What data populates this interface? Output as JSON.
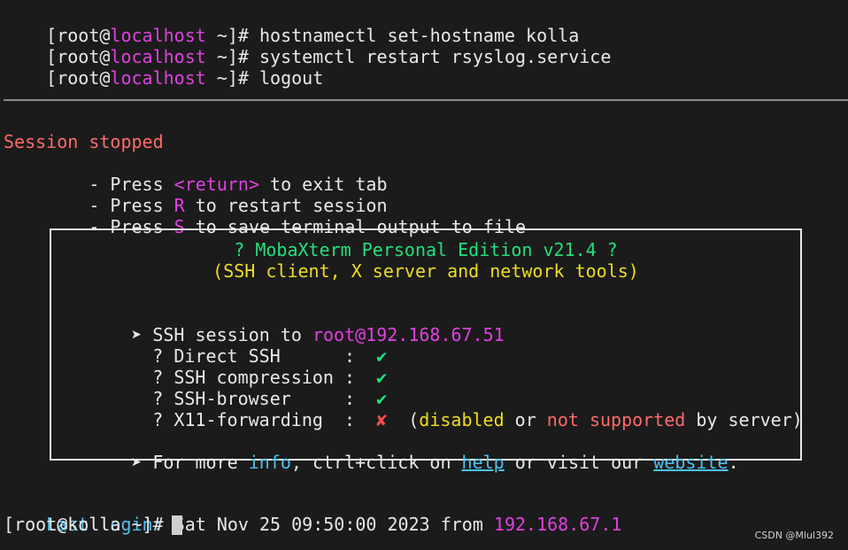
{
  "colors": {
    "background": "#1b1b1b",
    "text": "#e8e8e8",
    "magenta": "#e040e0",
    "red": "#ff6a6a",
    "cyan": "#4cc2f0",
    "green": "#22e07a",
    "yellow": "#eedd22",
    "divider": "#8a8a8a"
  },
  "history": [
    {
      "prompt_user": "[root@",
      "prompt_host": "localhost",
      "prompt_rest": " ~]# ",
      "command": "hostnamectl set-hostname kolla"
    },
    {
      "prompt_user": "[root@",
      "prompt_host": "localhost",
      "prompt_rest": " ~]# ",
      "command": "systemctl restart rsyslog.service"
    },
    {
      "prompt_user": "[root@",
      "prompt_host": "localhost",
      "prompt_rest": " ~]# ",
      "command": "logout"
    }
  ],
  "session": {
    "stopped_text": "Session stopped",
    "instructions": [
      {
        "prefix": "    - Press ",
        "key": "<return>",
        "suffix": " to exit tab"
      },
      {
        "prefix": "    - Press ",
        "key": "R",
        "suffix": " to restart session"
      },
      {
        "prefix": "    - Press ",
        "key": "S",
        "suffix": " to save terminal output to file"
      }
    ]
  },
  "mobabox": {
    "title": "? MobaXterm Personal Edition v21.4 ?",
    "subtitle": "(SSH client, X server and network tools)",
    "ssh_label": "➤ SSH session to ",
    "ssh_target": "root@192.168.67.51",
    "features": [
      {
        "label": "? Direct SSH      :  ",
        "mark": "✔",
        "mark_color": "green"
      },
      {
        "label": "? SSH compression :  ",
        "mark": "✔",
        "mark_color": "green"
      },
      {
        "label": "? SSH-browser     :  ",
        "mark": "✔",
        "mark_color": "green"
      },
      {
        "label": "? X11-forwarding  :  ",
        "mark": "✘",
        "mark_color": "red"
      }
    ],
    "x11_note": {
      "open": "  (",
      "disabled": "disabled",
      "or": " or ",
      "not_supported": "not supported",
      "tail": " by server)"
    },
    "more_info": {
      "prefix": "➤ For more ",
      "info": "info",
      "middle": ", ctrl+click on ",
      "help": "help",
      "middle2": " or visit our ",
      "website": "website",
      "end": "."
    }
  },
  "last_login": {
    "label": "Last login:",
    "text": " Sat Nov 25 09:50:00 2023 from ",
    "ip": "192.168.67.1"
  },
  "current_prompt": "[root@kolla ~]# ",
  "watermark": "CSDN @Mlul392"
}
